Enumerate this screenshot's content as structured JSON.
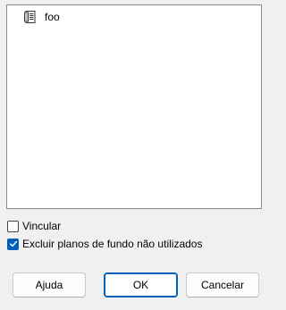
{
  "list": {
    "items": [
      {
        "label": "foo",
        "icon": "document-icon"
      }
    ]
  },
  "options": {
    "link": {
      "label": "Vincular",
      "checked": false
    },
    "exclude_unused": {
      "label": "Excluir planos de fundo não utilizados",
      "checked": true
    }
  },
  "buttons": {
    "help": "Ajuda",
    "ok": "OK",
    "cancel": "Cancelar"
  },
  "colors": {
    "accent": "#005fb8",
    "background": "#f0f0f0"
  }
}
